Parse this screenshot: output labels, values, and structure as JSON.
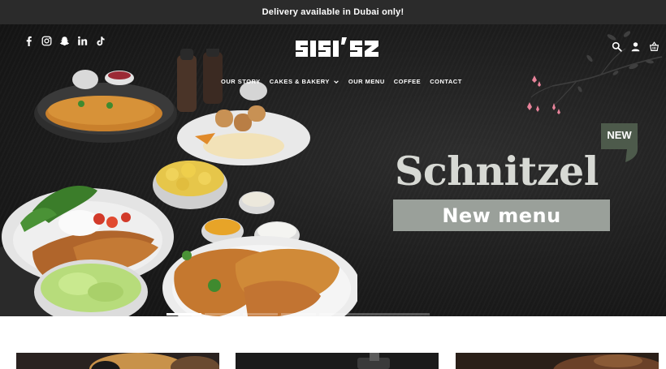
{
  "announcement": {
    "text": "Delivery available in Dubai only!"
  },
  "header": {
    "logo_text": "SISI'S",
    "socials": [
      "facebook-icon",
      "instagram-icon",
      "snapchat-icon",
      "linkedin-icon",
      "tiktok-icon"
    ],
    "nav": [
      {
        "label": "OUR STORY"
      },
      {
        "label": "CAKES & BAKERY",
        "has_dropdown": true
      },
      {
        "label": "OUR MENU"
      },
      {
        "label": "COFFEE"
      },
      {
        "label": "CONTACT"
      }
    ],
    "tools": [
      "search-icon",
      "account-icon",
      "cart-icon"
    ]
  },
  "hero": {
    "badge": "NEW",
    "headline": "Schnitzel",
    "subline": "New menu",
    "slides": 5,
    "active_slide": 1
  },
  "colors": {
    "announcement_bg": "#2b2b2b",
    "hero_bg": "#1d1d1d",
    "headline": "#d7d9d4",
    "subline_bg": "#9aa09a",
    "badge_green": "#4d5a4b",
    "blossom_pink": "#e8839a"
  }
}
